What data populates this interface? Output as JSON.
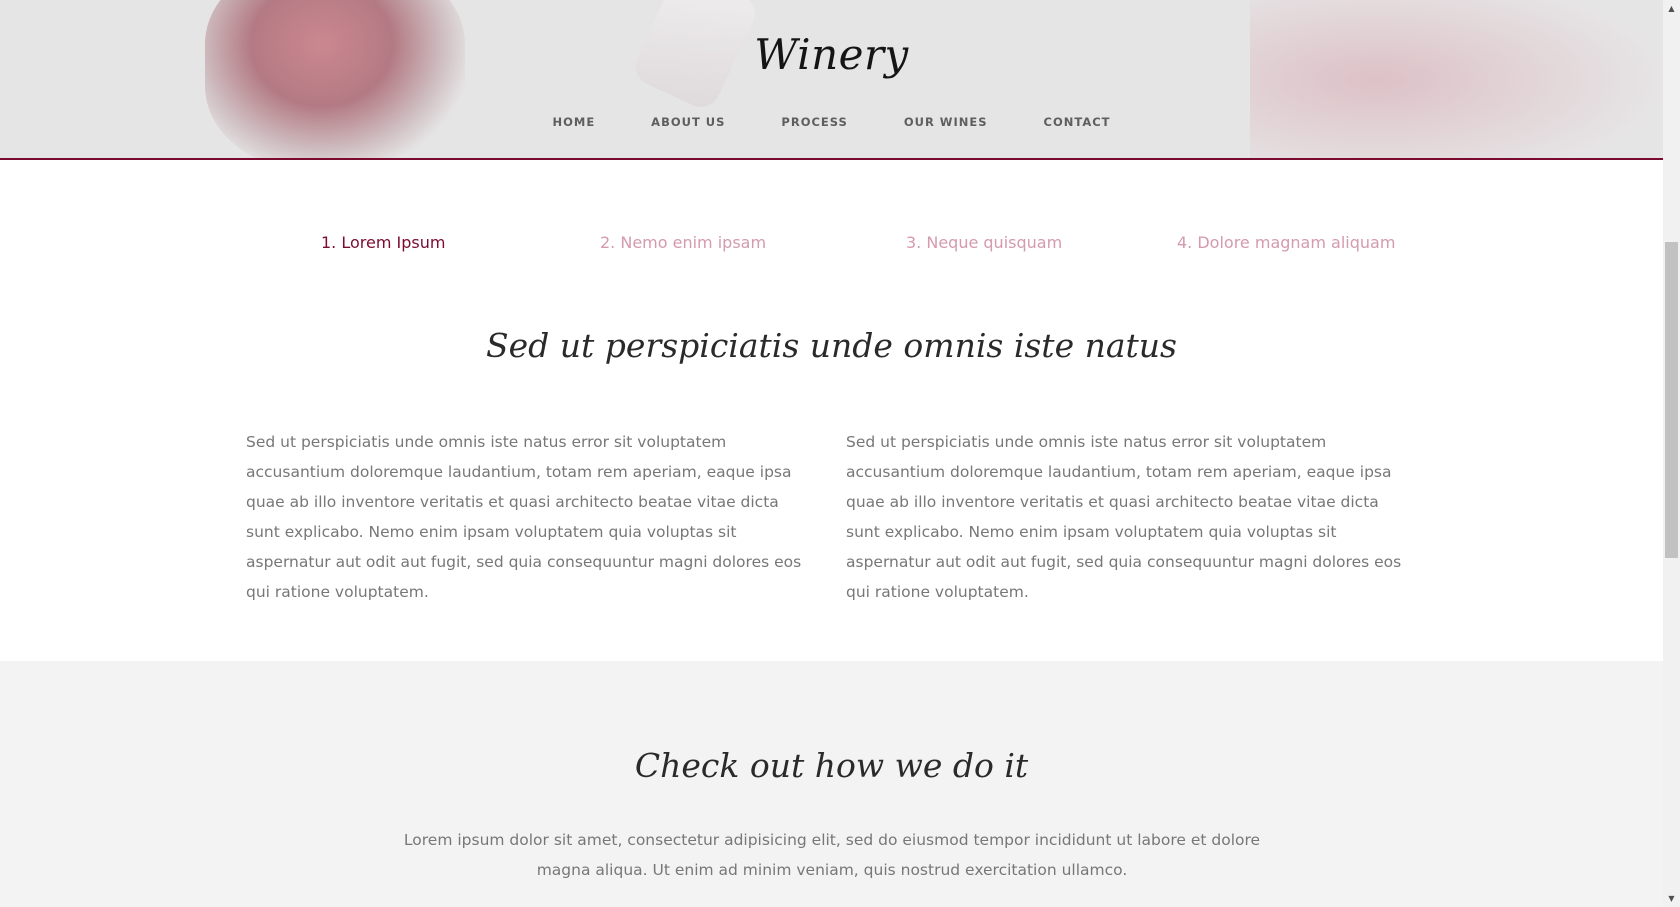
{
  "header": {
    "logo": "Winery",
    "nav": [
      "HOME",
      "ABOUT US",
      "PROCESS",
      "OUR WINES",
      "CONTACT"
    ]
  },
  "tabs": [
    "1. Lorem Ipsum",
    "2.  Nemo enim ipsam",
    "3. Neque quisquam",
    "4. Dolore magnam aliquam"
  ],
  "content": {
    "title": "Sed ut perspiciatis unde omnis iste natus",
    "col1": "Sed ut perspiciatis unde omnis iste natus error sit voluptatem accusantium doloremque laudantium, totam rem aperiam, eaque ipsa quae ab illo inventore veritatis et quasi architecto beatae vitae dicta sunt explicabo. Nemo enim ipsam voluptatem quia voluptas sit aspernatur aut odit aut fugit, sed quia consequuntur magni dolores eos qui ratione voluptatem.",
    "col2": "Sed ut perspiciatis unde omnis iste natus error sit voluptatem accusantium doloremque laudantium, totam rem aperiam, eaque ipsa quae ab illo inventore veritatis et quasi architecto beatae vitae dicta sunt explicabo. Nemo enim ipsam voluptatem quia voluptas sit aspernatur aut odit aut fugit, sed quia consequuntur magni dolores eos qui ratione voluptatem."
  },
  "process": {
    "title": "Check out how we do it",
    "text": "Lorem ipsum dolor sit amet, consectetur adipisicing elit, sed do eiusmod tempor incididunt ut labore et dolore magna aliqua. Ut enim ad minim veniam, quis nostrud exercitation ullamco."
  },
  "scrollbar": {
    "up_icon": "▲",
    "down_icon": "▼"
  },
  "colors": {
    "accent": "#7c0b33",
    "tab_inactive": "#d49aae",
    "body_text": "#777777",
    "header_bg": "#e6e5e6",
    "section_grey": "#f3f3f3"
  }
}
